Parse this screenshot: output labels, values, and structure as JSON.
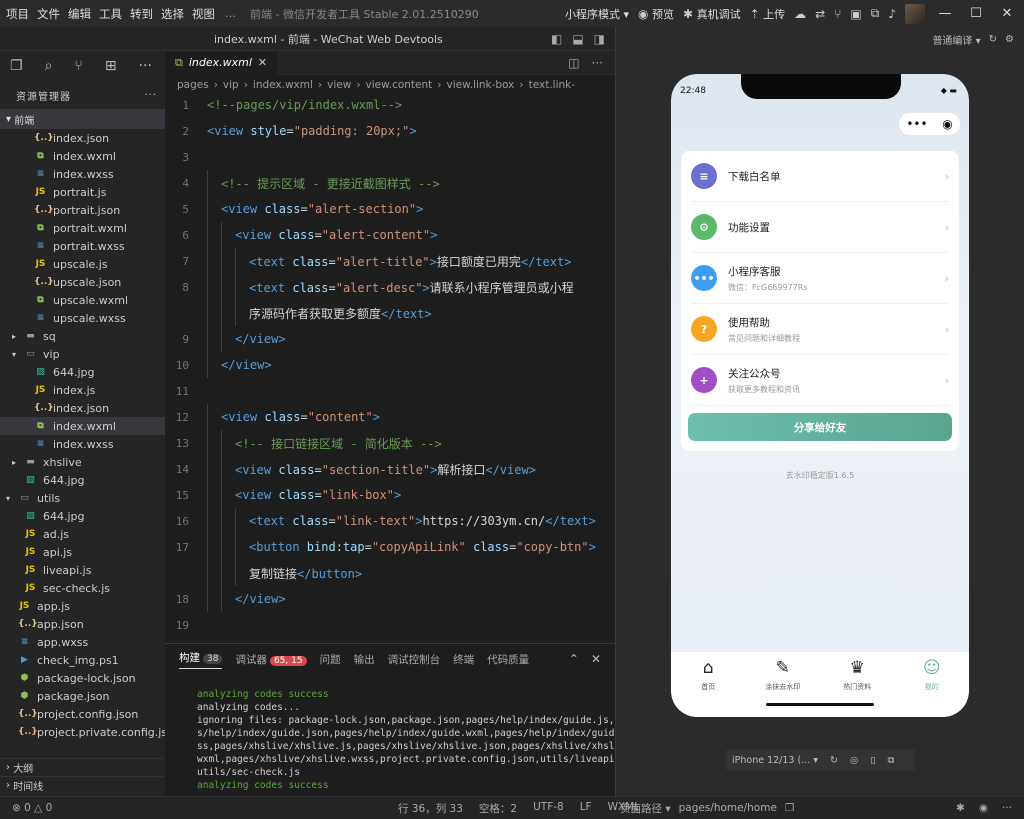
{
  "titlebar": {
    "menu": [
      "项目",
      "文件",
      "编辑",
      "工具",
      "转到",
      "选择",
      "视图"
    ],
    "more": "…",
    "app_title": "前端 - 微信开发者工具 Stable 2.01.2510290",
    "mode": "小程序模式",
    "preview": "预览",
    "remote_debug": "真机调试",
    "upload": "上传"
  },
  "subbar": {
    "window_title": "index.wxml - 前端 - WeChat Web Devtools"
  },
  "explorer": {
    "header": "资源管理器",
    "project": "前端",
    "items": [
      {
        "name": "index.json",
        "type": "json",
        "depth": 3
      },
      {
        "name": "index.wxml",
        "type": "wxml",
        "depth": 3
      },
      {
        "name": "index.wxss",
        "type": "wxss",
        "depth": 3
      },
      {
        "name": "portrait.js",
        "type": "js",
        "depth": 3
      },
      {
        "name": "portrait.json",
        "type": "json",
        "depth": 3
      },
      {
        "name": "portrait.wxml",
        "type": "wxml",
        "depth": 3
      },
      {
        "name": "portrait.wxss",
        "type": "wxss",
        "depth": 3
      },
      {
        "name": "upscale.js",
        "type": "js",
        "depth": 3
      },
      {
        "name": "upscale.json",
        "type": "json",
        "depth": 3
      },
      {
        "name": "upscale.wxml",
        "type": "wxml",
        "depth": 3
      },
      {
        "name": "upscale.wxss",
        "type": "wxss",
        "depth": 3
      },
      {
        "name": "sq",
        "type": "folder",
        "depth": 2
      },
      {
        "name": "vip",
        "type": "folder-open",
        "depth": 2
      },
      {
        "name": "644.jpg",
        "type": "img",
        "depth": 3
      },
      {
        "name": "index.js",
        "type": "js",
        "depth": 3
      },
      {
        "name": "index.json",
        "type": "json",
        "depth": 3
      },
      {
        "name": "index.wxml",
        "type": "wxml",
        "depth": 3,
        "selected": true
      },
      {
        "name": "index.wxss",
        "type": "wxss",
        "depth": 3
      },
      {
        "name": "xhslive",
        "type": "folder",
        "depth": 2
      },
      {
        "name": "644.jpg",
        "type": "img",
        "depth": 2
      },
      {
        "name": "utils",
        "type": "folder-open",
        "depth": 1
      },
      {
        "name": "644.jpg",
        "type": "img",
        "depth": 2
      },
      {
        "name": "ad.js",
        "type": "js",
        "depth": 2
      },
      {
        "name": "api.js",
        "type": "js",
        "depth": 2
      },
      {
        "name": "liveapi.js",
        "type": "js",
        "depth": 2
      },
      {
        "name": "sec-check.js",
        "type": "js",
        "depth": 2
      },
      {
        "name": "app.js",
        "type": "js",
        "depth": 1
      },
      {
        "name": "app.json",
        "type": "json",
        "depth": 1
      },
      {
        "name": "app.wxss",
        "type": "wxss",
        "depth": 1
      },
      {
        "name": "check_img.ps1",
        "type": "ps",
        "depth": 1
      },
      {
        "name": "package-lock.json",
        "type": "pkg",
        "depth": 1
      },
      {
        "name": "package.json",
        "type": "pkg",
        "depth": 1
      },
      {
        "name": "project.config.json",
        "type": "json",
        "depth": 1
      },
      {
        "name": "project.private.config.js...",
        "type": "json",
        "depth": 1
      }
    ],
    "outline": "大纲",
    "timeline": "时间线"
  },
  "editor": {
    "tab": "index.wxml",
    "breadcrumb": [
      "pages",
      "vip",
      "index.wxml",
      "view",
      "view.content",
      "view.link-box",
      "text.link-"
    ],
    "lines": [
      {
        "n": "1",
        "indent": 0,
        "parts": [
          [
            "c-cm",
            "<!--pages/vip/index.wxml-->"
          ]
        ]
      },
      {
        "n": "2",
        "indent": 0,
        "parts": [
          [
            "c-tg",
            "<view "
          ],
          [
            "c-at",
            "style"
          ],
          [
            "c-t",
            "="
          ],
          [
            "c-st",
            "\"padding: 20px;\""
          ],
          [
            "c-tg",
            ">"
          ]
        ]
      },
      {
        "n": "3",
        "indent": 0,
        "parts": []
      },
      {
        "n": "4",
        "indent": 1,
        "parts": [
          [
            "c-cm",
            "<!-- 提示区域 - 更接近截图样式 -->"
          ]
        ]
      },
      {
        "n": "5",
        "indent": 1,
        "parts": [
          [
            "c-tg",
            "<view "
          ],
          [
            "c-at",
            "class"
          ],
          [
            "c-t",
            "="
          ],
          [
            "c-st",
            "\"alert-section\""
          ],
          [
            "c-tg",
            ">"
          ]
        ]
      },
      {
        "n": "6",
        "indent": 2,
        "parts": [
          [
            "c-tg",
            "<view "
          ],
          [
            "c-at",
            "class"
          ],
          [
            "c-t",
            "="
          ],
          [
            "c-st",
            "\"alert-content\""
          ],
          [
            "c-tg",
            ">"
          ]
        ]
      },
      {
        "n": "7",
        "indent": 3,
        "parts": [
          [
            "c-tg",
            "<text "
          ],
          [
            "c-at",
            "class"
          ],
          [
            "c-t",
            "="
          ],
          [
            "c-st",
            "\"alert-title\""
          ],
          [
            "c-tg",
            ">"
          ],
          [
            "c-t",
            "接口额度已用完"
          ],
          [
            "c-tg",
            "</text>"
          ]
        ]
      },
      {
        "n": "8",
        "indent": 3,
        "parts": [
          [
            "c-tg",
            "<text "
          ],
          [
            "c-at",
            "class"
          ],
          [
            "c-t",
            "="
          ],
          [
            "c-st",
            "\"alert-desc\""
          ],
          [
            "c-tg",
            ">"
          ],
          [
            "c-t",
            "请联系小程序管理员或小程"
          ]
        ]
      },
      {
        "n": "",
        "indent": 3,
        "parts": [
          [
            "c-t",
            "序源码作者获取更多额度"
          ],
          [
            "c-tg",
            "</text>"
          ]
        ]
      },
      {
        "n": "9",
        "indent": 2,
        "parts": [
          [
            "c-tg",
            "</view>"
          ]
        ]
      },
      {
        "n": "10",
        "indent": 1,
        "parts": [
          [
            "c-tg",
            "</view>"
          ]
        ]
      },
      {
        "n": "11",
        "indent": 0,
        "parts": []
      },
      {
        "n": "12",
        "indent": 1,
        "parts": [
          [
            "c-tg",
            "<view "
          ],
          [
            "c-at",
            "class"
          ],
          [
            "c-t",
            "="
          ],
          [
            "c-st",
            "\"content\""
          ],
          [
            "c-tg",
            ">"
          ]
        ]
      },
      {
        "n": "13",
        "indent": 2,
        "parts": [
          [
            "c-cm",
            "<!-- 接口链接区域 - 简化版本 -->"
          ]
        ]
      },
      {
        "n": "14",
        "indent": 2,
        "parts": [
          [
            "c-tg",
            "<view "
          ],
          [
            "c-at",
            "class"
          ],
          [
            "c-t",
            "="
          ],
          [
            "c-st",
            "\"section-title\""
          ],
          [
            "c-tg",
            ">"
          ],
          [
            "c-t",
            "解析接口"
          ],
          [
            "c-tg",
            "</view>"
          ]
        ]
      },
      {
        "n": "15",
        "indent": 2,
        "parts": [
          [
            "c-tg",
            "<view "
          ],
          [
            "c-at",
            "class"
          ],
          [
            "c-t",
            "="
          ],
          [
            "c-st",
            "\"link-box\""
          ],
          [
            "c-tg",
            ">"
          ]
        ]
      },
      {
        "n": "16",
        "indent": 3,
        "parts": [
          [
            "c-tg",
            "<text "
          ],
          [
            "c-at",
            "class"
          ],
          [
            "c-t",
            "="
          ],
          [
            "c-st",
            "\"link-text\""
          ],
          [
            "c-tg",
            ">"
          ],
          [
            "c-t",
            "https://303ym.cn/"
          ],
          [
            "c-tg",
            "</text>"
          ]
        ]
      },
      {
        "n": "17",
        "indent": 3,
        "parts": [
          [
            "c-tg",
            "<button "
          ],
          [
            "c-at",
            "bind:tap"
          ],
          [
            "c-t",
            "="
          ],
          [
            "c-st",
            "\"copyApiLink\""
          ],
          [
            "c-t",
            " "
          ],
          [
            "c-at",
            "class"
          ],
          [
            "c-t",
            "="
          ],
          [
            "c-st",
            "\"copy-btn\""
          ],
          [
            "c-tg",
            ">"
          ]
        ]
      },
      {
        "n": "",
        "indent": 3,
        "parts": [
          [
            "c-t",
            "复制链接"
          ],
          [
            "c-tg",
            "</button>"
          ]
        ]
      },
      {
        "n": "18",
        "indent": 2,
        "parts": [
          [
            "c-tg",
            "</view>"
          ]
        ]
      },
      {
        "n": "19",
        "indent": 0,
        "parts": []
      }
    ]
  },
  "panel": {
    "tabs": [
      {
        "label": "构建",
        "badge": "38",
        "active": true
      },
      {
        "label": "调试器",
        "badge": "65, 15",
        "red": true
      },
      {
        "label": "问题"
      },
      {
        "label": "输出"
      },
      {
        "label": "调试控制台"
      },
      {
        "label": "终端"
      },
      {
        "label": "代码质量"
      }
    ],
    "output": [
      {
        "ok": true,
        "text": "analyzing codes success"
      },
      {
        "text": "analyzing codes..."
      },
      {
        "text": "ignoring files: package-lock.json,package.json,pages/help/index/guide.js,"
      },
      {
        "text": "s/help/index/guide.json,pages/help/index/guide.wxml,pages/help/index/guid"
      },
      {
        "text": "ss,pages/xhslive/xhslive.js,pages/xhslive/xhslive.json,pages/xhslive/xhsl"
      },
      {
        "text": "wxml,pages/xhslive/xhslive.wxss,project.private.config.json,utils/liveapi"
      },
      {
        "text": "utils/sec-check.js"
      },
      {
        "ok": true,
        "text": "analyzing codes success"
      }
    ]
  },
  "simulator": {
    "compile_mode": "普通编译",
    "time": "22:48",
    "menu": [
      {
        "title": "下载白名单",
        "sub": "",
        "color": "#6b6fcf",
        "glyph": "≡"
      },
      {
        "title": "功能设置",
        "sub": "",
        "color": "#5cb86a",
        "glyph": "⚙"
      },
      {
        "title": "小程序客服",
        "sub": "微信：FcG669977Rs",
        "color": "#3d9ef2",
        "glyph": "•••"
      },
      {
        "title": "使用帮助",
        "sub": "常见问题和详细教程",
        "color": "#f5a623",
        "glyph": "?"
      },
      {
        "title": "关注公众号",
        "sub": "获取更多教程和资讯",
        "color": "#a04fc4",
        "glyph": "+"
      }
    ],
    "share": "分享给好友",
    "version": "去水印稳定版1.6.5",
    "tabbar": [
      {
        "label": "首页",
        "icon": "home-icon",
        "glyph": "⌂"
      },
      {
        "label": "涂抹去水印",
        "icon": "brush-icon",
        "glyph": "✎"
      },
      {
        "label": "热门资料",
        "icon": "crown-icon",
        "glyph": "♛"
      },
      {
        "label": "我的",
        "icon": "profile-icon",
        "glyph": "☺",
        "active": true,
        "active_color": "#5fb89a"
      }
    ],
    "device": "iPhone 12/13 (..."
  },
  "status": {
    "errors": "⊗ 0 △ 0",
    "position": "行 36，列 33",
    "spaces": "空格：2",
    "encoding": "UTF-8",
    "eol": "LF",
    "lang": "WXML",
    "page_path_label": "页面路径",
    "page_path": "pages/home/home"
  }
}
